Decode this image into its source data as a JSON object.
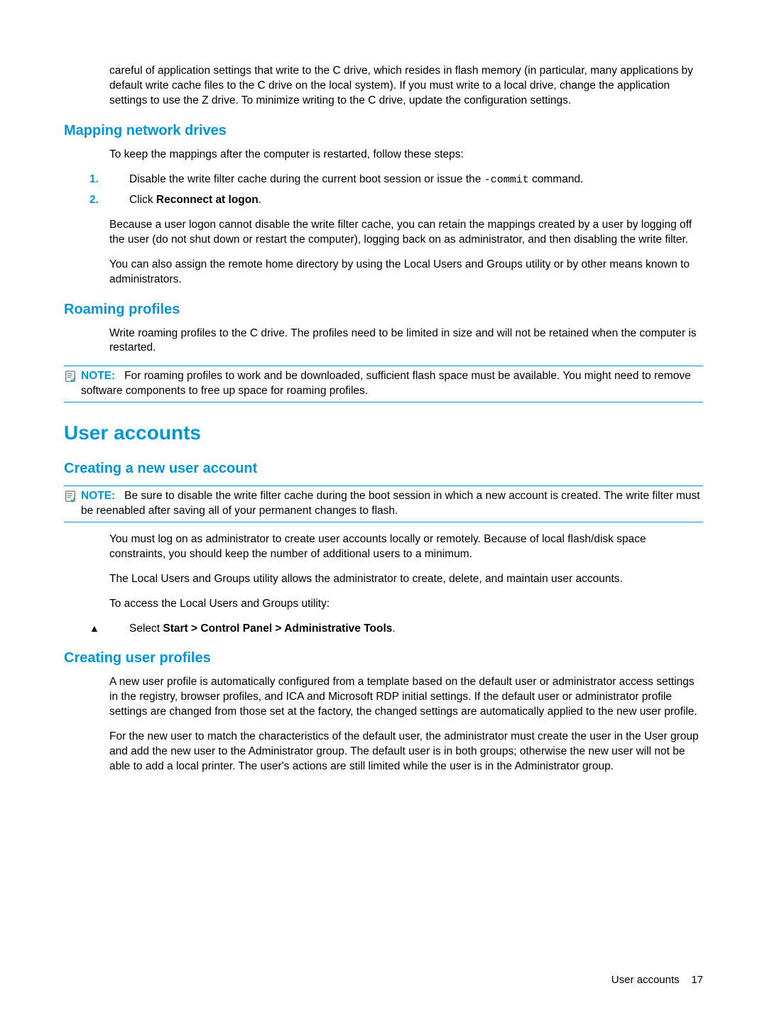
{
  "intro_para": "careful of application settings that write to the C drive, which resides in flash memory (in particular, many applications by default write cache files to the C drive on the local system). If you must write to a local drive, change the application settings to use the Z drive. To minimize writing to the C drive, update the configuration settings.",
  "mapping": {
    "heading": "Mapping network drives",
    "p1": "To keep the mappings after the computer is restarted, follow these steps:",
    "step1_num": "1.",
    "step1_pre": "Disable the write filter cache during the current boot session or issue the ",
    "step1_code": "-commit",
    "step1_post": " command.",
    "step2_num": "2.",
    "step2_pre": "Click ",
    "step2_bold": "Reconnect at logon",
    "step2_post": ".",
    "p2": "Because a user logon cannot disable the write filter cache, you can retain the mappings created by a user by logging off the user (do not shut down or restart the computer), logging back on as administrator, and then disabling the write filter.",
    "p3": "You can also assign the remote home directory by using the Local Users and Groups utility or by other means known to administrators."
  },
  "roaming": {
    "heading": "Roaming profiles",
    "p1": "Write roaming profiles to the C drive. The profiles need to be limited in size and will not be retained when the computer is restarted.",
    "note_label": "NOTE:",
    "note_text": "For roaming profiles to work and be downloaded, sufficient flash space must be available. You might need to remove software components to free up space for roaming profiles."
  },
  "user_accounts_heading": "User accounts",
  "creating_account": {
    "heading": "Creating a new user account",
    "note_label": "NOTE:",
    "note_text": "Be sure to disable the write filter cache during the boot session in which a new account is created. The write filter must be reenabled after saving all of your permanent changes to flash.",
    "p1": "You must log on as administrator to create user accounts locally or remotely. Because of local flash/disk space constraints, you should keep the number of additional users to a minimum.",
    "p2": "The Local Users and Groups utility allows the administrator to create, delete, and maintain user accounts.",
    "p3": "To access the Local Users and Groups utility:",
    "step_tri": "▲",
    "step_pre": "Select ",
    "step_bold": "Start > Control Panel > Administrative Tools",
    "step_post": "."
  },
  "creating_profiles": {
    "heading": "Creating user profiles",
    "p1": "A new user profile is automatically configured from a template based on the default user or administrator access settings in the registry, browser profiles, and ICA and Microsoft RDP initial settings. If the default user or administrator profile settings are changed from those set at the factory, the changed settings are automatically applied to the new user profile.",
    "p2": "For the new user to match the characteristics of the default user, the administrator must create the user in the User group and add the new user to the Administrator group. The default user is in both groups; otherwise the new user will not be able to add a local printer. The user's actions are still limited while the user is in the Administrator group."
  },
  "footer": {
    "section": "User accounts",
    "page": "17"
  },
  "icons": {
    "note": "note-icon"
  }
}
